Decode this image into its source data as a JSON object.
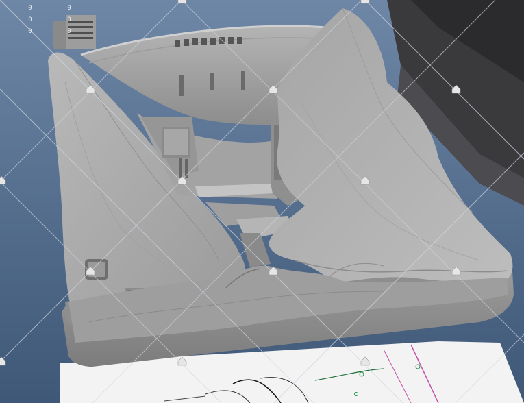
{
  "viewport": {
    "background_top": "#6f87a6",
    "background_bottom": "#3f5878",
    "model_color": "#a9a9a9",
    "model_shadow": "#7f7f7f",
    "wire_color": "#cfd6df",
    "hud_col1": [
      "0",
      "0",
      "0"
    ],
    "hud_col2": [
      "0",
      "0",
      "0"
    ],
    "pivot_icon": "house-pivot-icon"
  }
}
